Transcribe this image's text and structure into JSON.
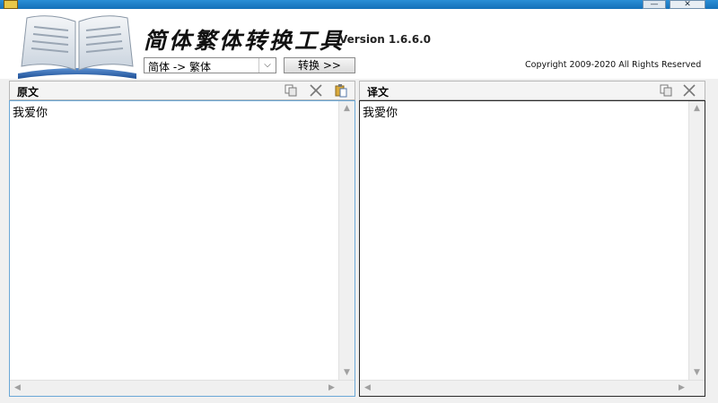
{
  "window": {
    "minimize_glyph": "—",
    "close_glyph": "✕"
  },
  "header": {
    "title": "简体繁体转换工具",
    "version": "Version 1.6.6.0",
    "mode_value": "简体 -> 繁体",
    "convert_label": "转换 >>",
    "copyright": "Copyright 2009-2020 All Rights Reserved"
  },
  "source_panel": {
    "title": "原文",
    "text": "我爱你"
  },
  "result_panel": {
    "title": "译文",
    "text": "我愛你"
  },
  "scroll": {
    "up": "▲",
    "down": "▼",
    "left": "◀",
    "right": "▶"
  },
  "colors": {
    "titlebar": "#1f7fcb",
    "source_border": "#6aa7d6",
    "result_border": "#2a2a2a"
  },
  "icons": {
    "copy": "copy-icon",
    "cut": "cut-icon",
    "paste": "paste-icon"
  }
}
